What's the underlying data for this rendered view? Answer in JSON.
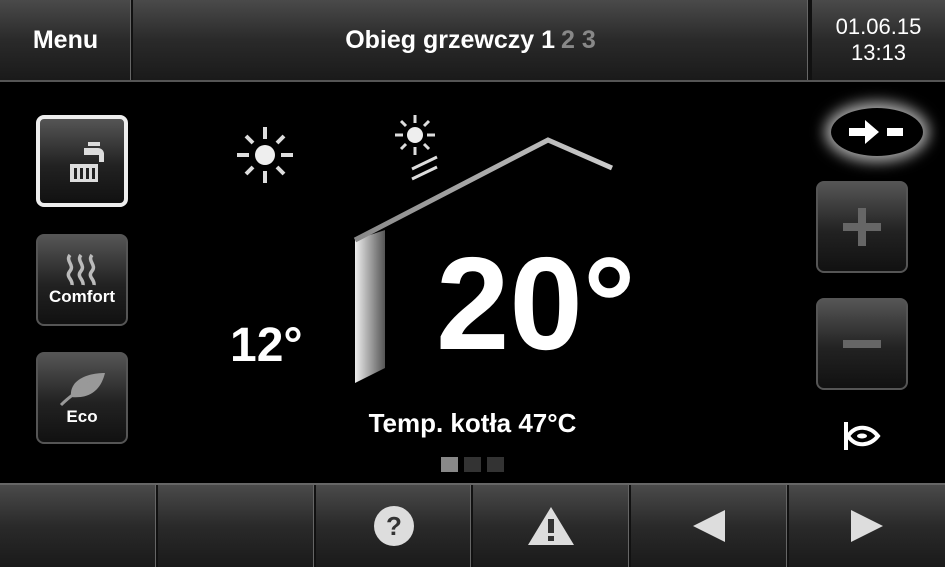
{
  "header": {
    "menu_label": "Menu",
    "title": "Obieg grzewczy",
    "circuit_active": "1",
    "circuit_others": "2 3",
    "date": "01.06.15",
    "time": "13:13"
  },
  "modes": [
    {
      "label": "",
      "icon": "radiator-tap-icon",
      "selected": true
    },
    {
      "label": "Comfort",
      "icon": "heat-waves-icon",
      "selected": false
    },
    {
      "label": "Eco",
      "icon": "leaf-icon",
      "selected": false
    }
  ],
  "main": {
    "outdoor_temp": "12°",
    "room_temp": "20°",
    "boiler_temp": "Temp. kotła 47°C",
    "page_count": 3,
    "current_page": 1
  },
  "right": {
    "mode_pill_icon": "arrow-dash-icon",
    "plus_icon": "plus-icon",
    "minus_icon": "minus-icon",
    "bottom_icon": "eye-symbol-icon"
  },
  "footer": {
    "icons": [
      "",
      "",
      "help-icon",
      "warning-icon",
      "triangle-left-icon",
      "triangle-right-icon"
    ]
  }
}
